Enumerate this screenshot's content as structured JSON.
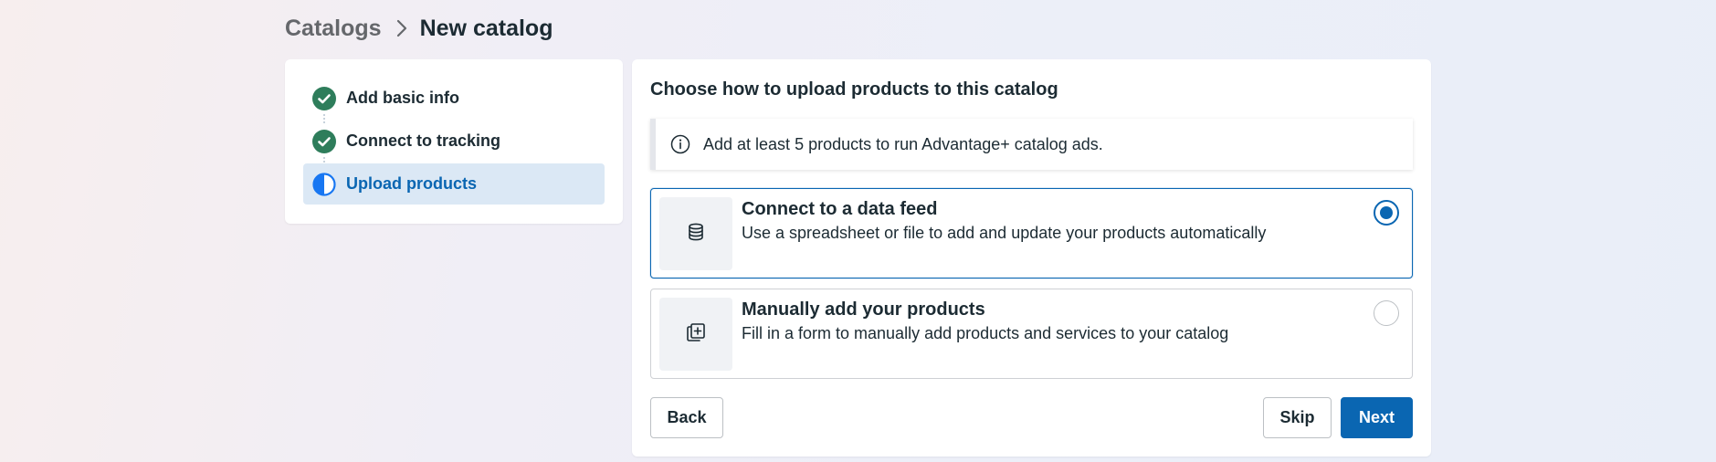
{
  "breadcrumb": {
    "parent": "Catalogs",
    "current": "New catalog"
  },
  "steps": [
    {
      "label": "Add basic info",
      "status": "complete",
      "icon": "check-circle-icon"
    },
    {
      "label": "Connect to tracking",
      "status": "complete",
      "icon": "check-circle-icon"
    },
    {
      "label": "Upload products",
      "status": "in-progress",
      "icon": "half-circle-icon"
    }
  ],
  "main": {
    "title": "Choose how to upload products to this catalog",
    "notice": "Add at least 5 products to run Advantage+ catalog ads.",
    "options": [
      {
        "title": "Connect to a data feed",
        "description": "Use a spreadsheet or file to add and update your products automatically",
        "icon": "database-icon",
        "selected": true
      },
      {
        "title": "Manually add your products",
        "description": "Fill in a form to manually add products and services to your catalog",
        "icon": "add-cards-icon",
        "selected": false
      }
    ]
  },
  "buttons": {
    "back": "Back",
    "skip": "Skip",
    "next": "Next"
  },
  "colors": {
    "accent": "#0a66b2",
    "success": "#2e7d5b",
    "active_step_bg": "#dbe8f5"
  }
}
